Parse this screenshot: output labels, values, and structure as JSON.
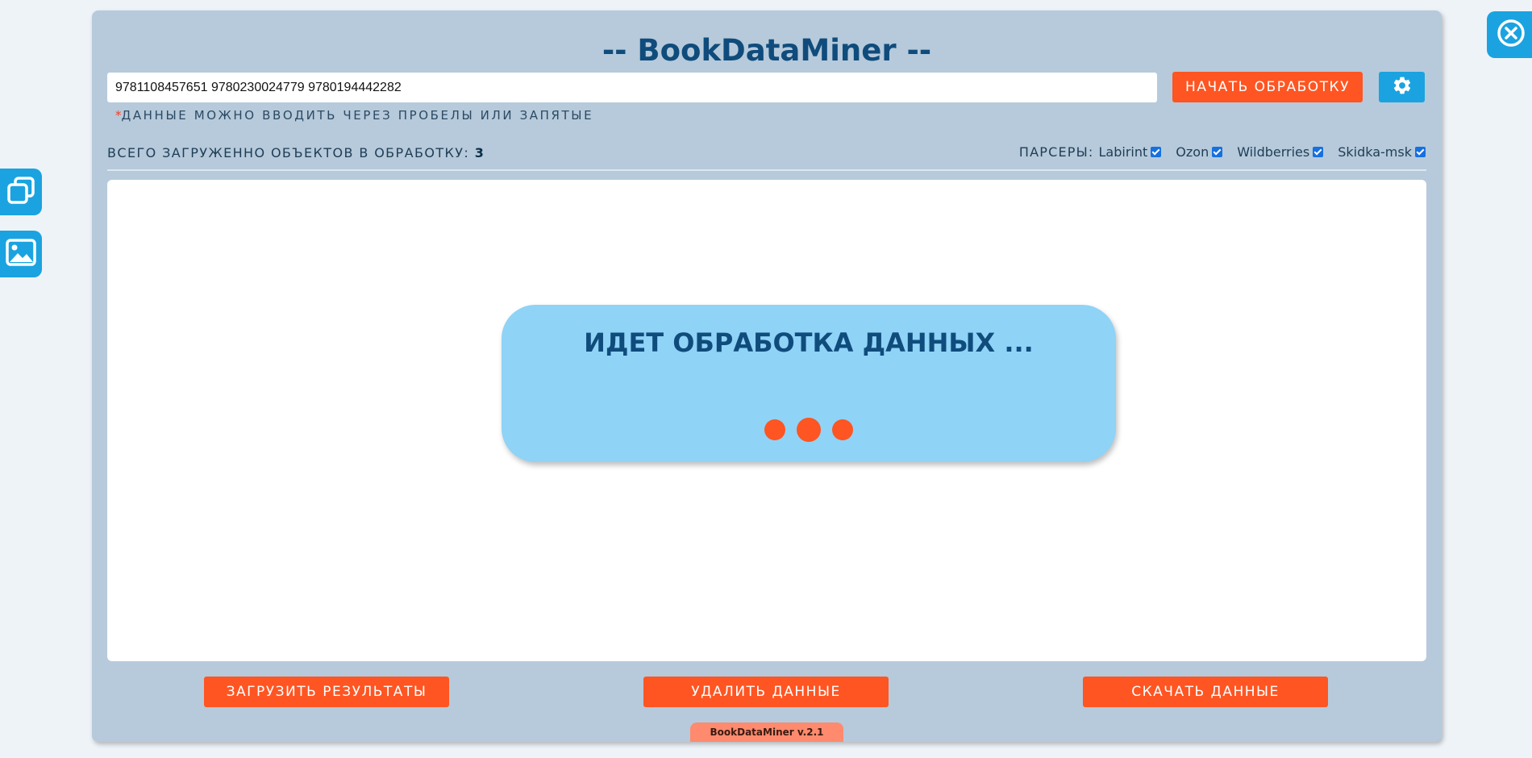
{
  "app": {
    "title": "-- BookDataMiner --",
    "version": "BookDataMiner v.2.1"
  },
  "input": {
    "value": "9781108457651 9780230024779 9780194442282",
    "hint_marker": "*",
    "hint": "ДАННЫЕ МОЖНО ВВОДИТЬ ЧЕРЕЗ ПРОБЕЛЫ ИЛИ ЗАПЯТЫЕ"
  },
  "toolbar": {
    "start_label": "НАЧАТЬ ОБРАБОТКУ",
    "settings_icon": "gear-icon"
  },
  "summary": {
    "total_label": "ВСЕГО ЗАГРУЖЕННО ОБЪЕКТОВ В ОБРАБОТКУ:",
    "total_count": "3"
  },
  "parsers": {
    "label": "ПАРСЕРЫ:",
    "items": [
      {
        "name": "Labirint",
        "checked": true
      },
      {
        "name": "Ozon",
        "checked": true
      },
      {
        "name": "Wildberries",
        "checked": true
      },
      {
        "name": "Skidka-msk",
        "checked": true
      }
    ]
  },
  "loader": {
    "text": "ИДЕТ ОБРАБОТКА ДАННЫХ ..."
  },
  "actions": {
    "upload_label": "ЗАГРУЗИТЬ РЕЗУЛЬТАТЫ",
    "delete_label": "УДАЛИТЬ ДАННЫЕ",
    "download_label": "СКАЧАТЬ ДАННЫЕ"
  },
  "side_panel": {
    "window_icon": "window-stack-icon",
    "image_icon": "image-icon",
    "close_icon": "close-icon"
  },
  "colors": {
    "accent_orange": "#ff5522",
    "accent_blue": "#1aa3e0",
    "panel_bg": "#b6cadb",
    "title_color": "#0f4c7c",
    "loader_bg": "#8fd3f7"
  }
}
